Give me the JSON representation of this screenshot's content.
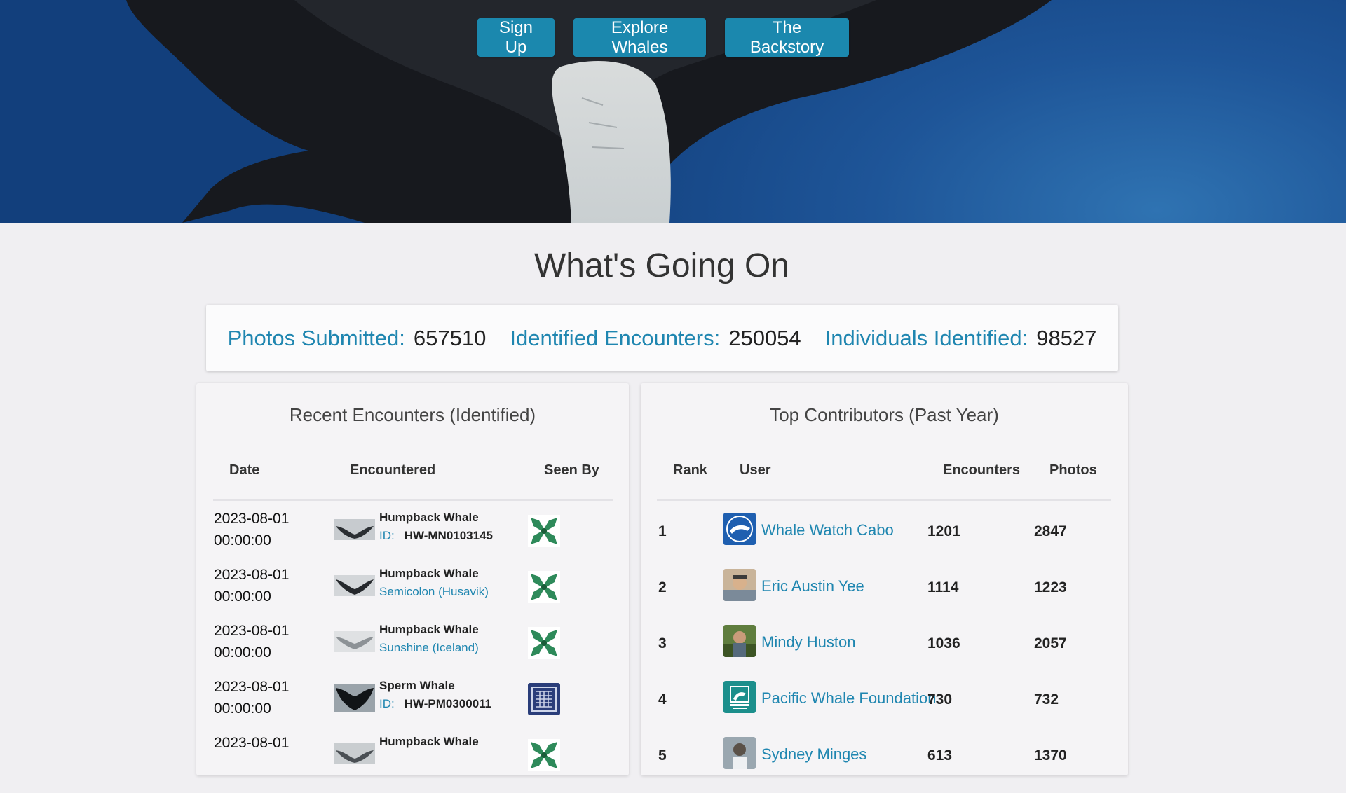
{
  "hero": {
    "buttons": {
      "sign_up": "Sign Up",
      "explore_whales": "Explore Whales",
      "backstory": "The Backstory"
    }
  },
  "main_title": "What's Going On",
  "stats": [
    {
      "label": "Photos Submitted:",
      "value": "657510"
    },
    {
      "label": "Identified Encounters:",
      "value": "250054"
    },
    {
      "label": "Individuals Identified:",
      "value": "98527"
    }
  ],
  "recent_encounters": {
    "title": "Recent Encounters (Identified)",
    "columns": [
      "Date",
      "Encountered",
      "Seen By"
    ],
    "rows": [
      {
        "date": "2023-08-01",
        "time": "00:00:00",
        "species": "Humpback Whale",
        "id_label": "ID:",
        "id_value": "HW-MN0103145",
        "name_link": "",
        "seen_by_icon": "green-pattern-avatar-icon"
      },
      {
        "date": "2023-08-01",
        "time": "00:00:00",
        "species": "Humpback Whale",
        "id_label": "",
        "id_value": "",
        "name_link": "Semicolon (Husavik)",
        "seen_by_icon": "green-pattern-avatar-icon"
      },
      {
        "date": "2023-08-01",
        "time": "00:00:00",
        "species": "Humpback Whale",
        "id_label": "",
        "id_value": "",
        "name_link": "Sunshine (Iceland)",
        "seen_by_icon": "green-pattern-avatar-icon"
      },
      {
        "date": "2023-08-01",
        "time": "00:00:00",
        "species": "Sperm Whale",
        "id_label": "ID:",
        "id_value": "HW-PM0300011",
        "name_link": "",
        "seen_by_icon": "blue-pattern-avatar-icon"
      },
      {
        "date": "2023-08-01",
        "time": "",
        "species": "Humpback Whale",
        "id_label": "",
        "id_value": "",
        "name_link": "",
        "seen_by_icon": "green-pattern-avatar-icon"
      }
    ]
  },
  "top_contributors": {
    "title": "Top Contributors (Past Year)",
    "columns": [
      "Rank",
      "User",
      "Encounters",
      "Photos"
    ],
    "rows": [
      {
        "rank": "1",
        "user": "Whale Watch Cabo",
        "encounters": "1201",
        "photos": "2847"
      },
      {
        "rank": "2",
        "user": "Eric Austin Yee",
        "encounters": "1114",
        "photos": "1223"
      },
      {
        "rank": "3",
        "user": "Mindy Huston",
        "encounters": "1036",
        "photos": "2057"
      },
      {
        "rank": "4",
        "user": "Pacific Whale Foundation",
        "encounters": "730",
        "photos": "732"
      },
      {
        "rank": "5",
        "user": "Sydney Minges",
        "encounters": "613",
        "photos": "1370"
      }
    ]
  },
  "colors": {
    "accent": "#1f86b0",
    "button": "#1b88ae",
    "page_bg": "#f0eff2",
    "hero_blue": "#1e5598"
  }
}
